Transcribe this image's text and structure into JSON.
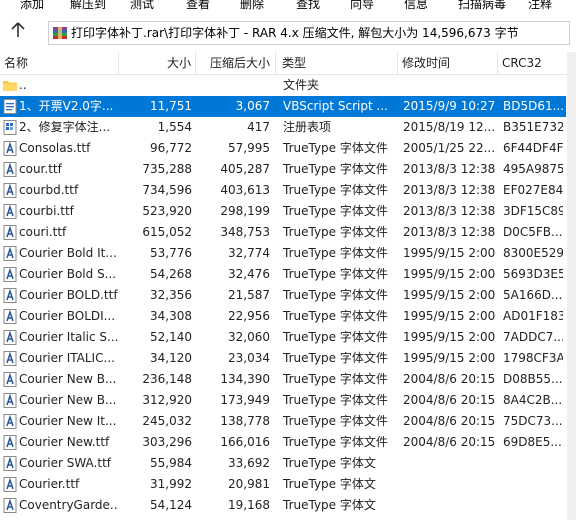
{
  "toolbar": {
    "items": [
      "添加",
      "解压到",
      "测试",
      "查看",
      "删除",
      "查找",
      "向导",
      "信息",
      "扫描病毒",
      "注释"
    ]
  },
  "path": {
    "text": "打印字体补丁.rar\\打印字体补丁 - RAR 4.x 压缩文件, 解包大小为 14,596,673 字节"
  },
  "columns": {
    "name": "名称",
    "size": "大小",
    "packed": "压缩后大小",
    "type": "类型",
    "modified": "修改时间",
    "crc": "CRC32"
  },
  "files": [
    {
      "name": "..",
      "size": "",
      "packed": "",
      "type": "文件夹",
      "modified": "",
      "crc": "",
      "icon": "folder-icon"
    },
    {
      "name": "1、开票V2.0字...",
      "size": "11,751",
      "packed": "3,067",
      "type": "VBScript Script ...",
      "modified": "2015/9/9 10:27",
      "crc": "BD5D61...",
      "icon": "vbscript-file-icon",
      "selected": true
    },
    {
      "name": "2、修复字体注...",
      "size": "1,554",
      "packed": "417",
      "type": "注册表项",
      "modified": "2015/8/19 12...",
      "crc": "B351E732",
      "icon": "registry-file-icon"
    },
    {
      "name": "Consolas.ttf",
      "size": "96,772",
      "packed": "57,995",
      "type": "TrueType 字体文件",
      "modified": "2005/1/25 22...",
      "crc": "6F44DF4F",
      "icon": "font-file-icon"
    },
    {
      "name": "cour.ttf",
      "size": "735,288",
      "packed": "405,287",
      "type": "TrueType 字体文件",
      "modified": "2013/8/3 12:38",
      "crc": "495A9875",
      "icon": "font-file-icon"
    },
    {
      "name": "courbd.ttf",
      "size": "734,596",
      "packed": "403,613",
      "type": "TrueType 字体文件",
      "modified": "2013/8/3 12:38",
      "crc": "EF027E84",
      "icon": "font-file-icon"
    },
    {
      "name": "courbi.ttf",
      "size": "523,920",
      "packed": "298,199",
      "type": "TrueType 字体文件",
      "modified": "2013/8/3 12:38",
      "crc": "3DF15C89",
      "icon": "font-file-icon"
    },
    {
      "name": "couri.ttf",
      "size": "615,052",
      "packed": "348,753",
      "type": "TrueType 字体文件",
      "modified": "2013/8/3 12:38",
      "crc": "D0C5FB...",
      "icon": "font-file-icon"
    },
    {
      "name": "Courier Bold It...",
      "size": "53,776",
      "packed": "32,774",
      "type": "TrueType 字体文件",
      "modified": "1995/9/15 2:00",
      "crc": "8300E529",
      "icon": "font-file-icon"
    },
    {
      "name": "Courier Bold S...",
      "size": "54,268",
      "packed": "32,476",
      "type": "TrueType 字体文件",
      "modified": "1995/9/15 2:00",
      "crc": "5693D3E5",
      "icon": "font-file-icon"
    },
    {
      "name": "Courier BOLD.ttf",
      "size": "32,356",
      "packed": "21,587",
      "type": "TrueType 字体文件",
      "modified": "1995/9/15 2:00",
      "crc": "5A166D...",
      "icon": "font-file-icon"
    },
    {
      "name": "Courier BOLDI...",
      "size": "34,308",
      "packed": "22,956",
      "type": "TrueType 字体文件",
      "modified": "1995/9/15 2:00",
      "crc": "AD01F183",
      "icon": "font-file-icon"
    },
    {
      "name": "Courier Italic S...",
      "size": "52,140",
      "packed": "32,060",
      "type": "TrueType 字体文件",
      "modified": "1995/9/15 2:00",
      "crc": "7ADDC7...",
      "icon": "font-file-icon"
    },
    {
      "name": "Courier ITALIC...",
      "size": "34,120",
      "packed": "23,034",
      "type": "TrueType 字体文件",
      "modified": "1995/9/15 2:00",
      "crc": "1798CF3A",
      "icon": "font-file-icon"
    },
    {
      "name": "Courier New B...",
      "size": "236,148",
      "packed": "134,390",
      "type": "TrueType 字体文件",
      "modified": "2004/8/6 20:15",
      "crc": "D08B55...",
      "icon": "font-file-icon"
    },
    {
      "name": "Courier New B...",
      "size": "312,920",
      "packed": "173,949",
      "type": "TrueType 字体文件",
      "modified": "2004/8/6 20:15",
      "crc": "8A4C2B...",
      "icon": "font-file-icon"
    },
    {
      "name": "Courier New It...",
      "size": "245,032",
      "packed": "138,778",
      "type": "TrueType 字体文件",
      "modified": "2004/8/6 20:15",
      "crc": "75DC73...",
      "icon": "font-file-icon"
    },
    {
      "name": "Courier New.ttf",
      "size": "303,296",
      "packed": "166,016",
      "type": "TrueType 字体文件",
      "modified": "2004/8/6 20:15",
      "crc": "69D8E5...",
      "icon": "font-file-icon"
    },
    {
      "name": "Courier SWA.ttf",
      "size": "55,984",
      "packed": "33,692",
      "type": "TrueType 字体文",
      "modified": "",
      "crc": "",
      "icon": "font-file-icon"
    },
    {
      "name": "Courier.ttf",
      "size": "31,992",
      "packed": "20,981",
      "type": "TrueType 字体文",
      "modified": "",
      "crc": "",
      "icon": "font-file-icon"
    },
    {
      "name": "CoventryGarde...",
      "size": "54,124",
      "packed": "19,168",
      "type": "TrueType 字体文",
      "modified": "",
      "crc": "",
      "icon": "font-file-icon"
    }
  ],
  "colors": {
    "selection": "#0078d7",
    "header_border": "#e5e5e5",
    "font_icon_blue": "#2b579a"
  }
}
